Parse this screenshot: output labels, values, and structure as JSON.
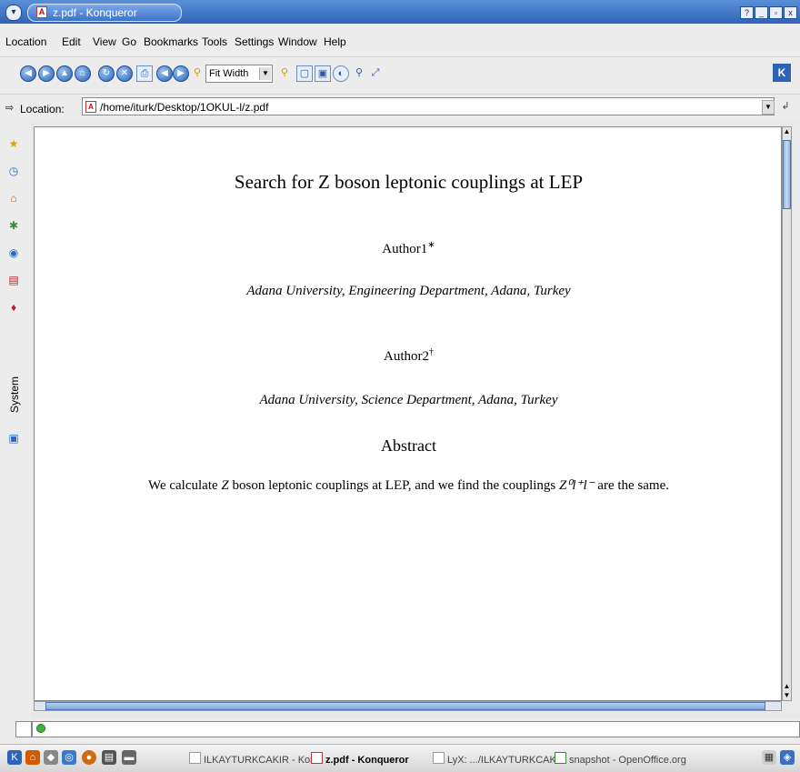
{
  "window": {
    "title": "z.pdf - Konqueror",
    "controls": {
      "help": "?",
      "minimize": "_",
      "maximize": "▫",
      "close": "x"
    }
  },
  "menubar": {
    "items": [
      "Location",
      "Edit",
      "View",
      "Go",
      "Bookmarks",
      "Tools",
      "Settings",
      "Window",
      "Help"
    ]
  },
  "toolbar": {
    "zoom": "Fit Width",
    "icons": [
      "back-icon",
      "forward-icon",
      "up-icon",
      "home-icon",
      "reload-icon",
      "stop-icon",
      "print-icon",
      "previous-page-icon",
      "next-page-icon",
      "zoom-icon",
      "single-page-icon",
      "facing-pages-icon",
      "rotate-icon",
      "find-icon",
      "fit-page-icon"
    ]
  },
  "location": {
    "label": "Location:",
    "value": "/home/iturk/Desktop/1OKUL-l/z.pdf"
  },
  "sidebar": {
    "items": [
      "bookmarks-icon",
      "history-icon",
      "home-folder-icon",
      "network-icon",
      "services-icon",
      "media-icon",
      "root-folder-icon",
      "devices-icon"
    ],
    "system_label": "System"
  },
  "document": {
    "title": "Search for Z boson leptonic couplings at LEP",
    "author1": "Author1",
    "author1_mark": "∗",
    "affil1": "Adana University, Engineering Department, Adana, Turkey",
    "author2": "Author2",
    "author2_mark": "†",
    "affil2": "Adana University, Science Department, Adana, Turkey",
    "abstract_heading": "Abstract",
    "abstract_part1": "We calculate ",
    "abstract_z": "Z",
    "abstract_part2": " boson leptonic couplings at LEP, and we find the couplings ",
    "abstract_formula": "Z⁰l⁺l⁻",
    "abstract_part3": " are the same."
  },
  "taskbar": {
    "tasks": [
      {
        "label": "ILKAYTURKCAKIR - Kon",
        "active": false
      },
      {
        "label": "z.pdf - Konqueror",
        "active": true
      },
      {
        "label": "LyX: .../ILKAYTURKCAKIF",
        "active": false
      },
      {
        "label": "snapshot - OpenOffice.org",
        "active": false
      }
    ]
  },
  "colors": {
    "titlebar": "#3a6fc4",
    "accent": "#2f63b8"
  }
}
